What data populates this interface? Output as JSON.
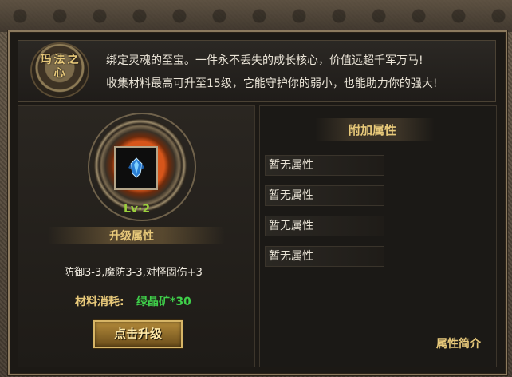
{
  "header": {
    "emblem_text": "玛法之心",
    "description_line1": "绑定灵魂的至宝。一件永不丢失的成长核心，价值远超千军万马!",
    "description_line2": "收集材料最高可升至15级，它能守护你的弱小，也能助力你的强大!"
  },
  "upgrade": {
    "level": "Lv·2",
    "section_label": "升级属性",
    "stats": "防御3-3,魔防3-3,对怪固伤+3",
    "cost_label": "材料消耗:",
    "cost_value": "绿晶矿*30",
    "button_label": "点击升级"
  },
  "attributes": {
    "title": "附加属性",
    "items": [
      "暂无属性",
      "暂无属性",
      "暂无属性",
      "暂无属性"
    ],
    "intro_link": "属性简介"
  },
  "colors": {
    "gold": "#e8c97a",
    "green_level": "#9bd13c",
    "green_cost": "#3fd04a"
  },
  "icons": {
    "emblem": "heart-of-mafa-emblem",
    "item": "blue-crystal-icon"
  }
}
